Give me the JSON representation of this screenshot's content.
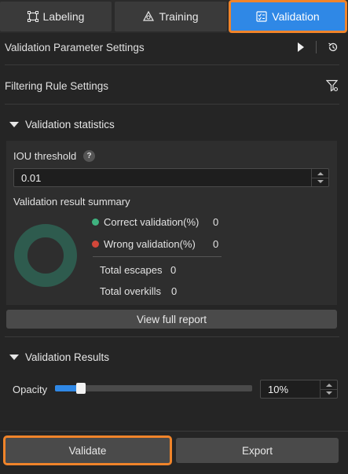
{
  "tabs": [
    {
      "label": "Labeling",
      "icon": "labeling-icon"
    },
    {
      "label": "Training",
      "icon": "training-icon"
    },
    {
      "label": "Validation",
      "icon": "validation-icon",
      "active": true
    }
  ],
  "settings": {
    "validation_params_label": "Validation Parameter Settings",
    "filtering_rules_label": "Filtering Rule Settings"
  },
  "statistics": {
    "header": "Validation statistics",
    "iou_label": "IOU threshold",
    "iou_value": "0.01",
    "summary_label": "Validation result summary",
    "correct_label": "Correct validation(%)",
    "correct_value": "0",
    "wrong_label": "Wrong validation(%)",
    "wrong_value": "0",
    "escapes_label": "Total escapes",
    "escapes_value": "0",
    "overkills_label": "Total overkills",
    "overkills_value": "0",
    "report_button": "View full report"
  },
  "results": {
    "header": "Validation Results",
    "opacity_label": "Opacity",
    "opacity_value": "10%",
    "opacity_level": 0.1
  },
  "actions": {
    "validate": "Validate",
    "export": "Export"
  },
  "colors": {
    "accent": "#2f88e6",
    "highlight": "#f0842a",
    "correct": "#3fb27f",
    "wrong": "#d2473a",
    "donut": "#2e5b4e"
  }
}
